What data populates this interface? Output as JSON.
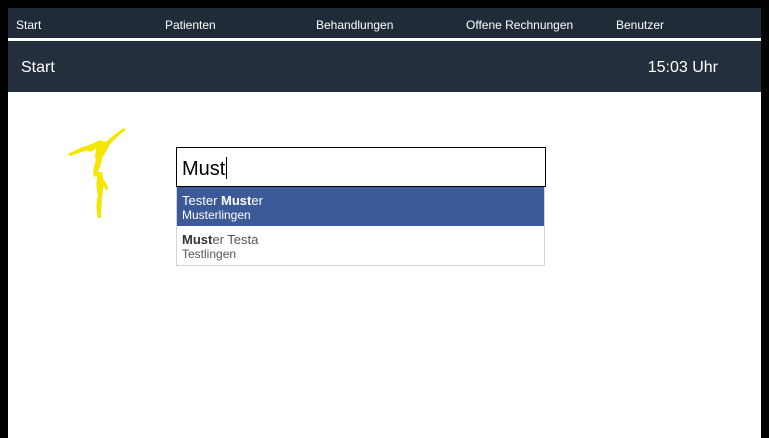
{
  "nav": {
    "items": [
      {
        "label": "Start"
      },
      {
        "label": "Patienten"
      },
      {
        "label": "Behandlungen"
      },
      {
        "label": "Offene Rechnungen"
      },
      {
        "label": "Benutzer"
      }
    ]
  },
  "header": {
    "title": "Start",
    "time": "15:03 Uhr"
  },
  "search": {
    "value": "Must"
  },
  "suggestions": [
    {
      "name_before": "Tester ",
      "name_match": "Must",
      "name_after": "er",
      "location": "Musterlingen",
      "selected": true
    },
    {
      "name_before": "",
      "name_match": "Must",
      "name_after": "er Testa",
      "location": "Testlingen",
      "selected": false
    }
  ],
  "colors": {
    "nav_bg": "#1f2b38",
    "header_bg": "#232f3d",
    "selected_bg": "#3c5a98",
    "logo": "#f5e600"
  }
}
